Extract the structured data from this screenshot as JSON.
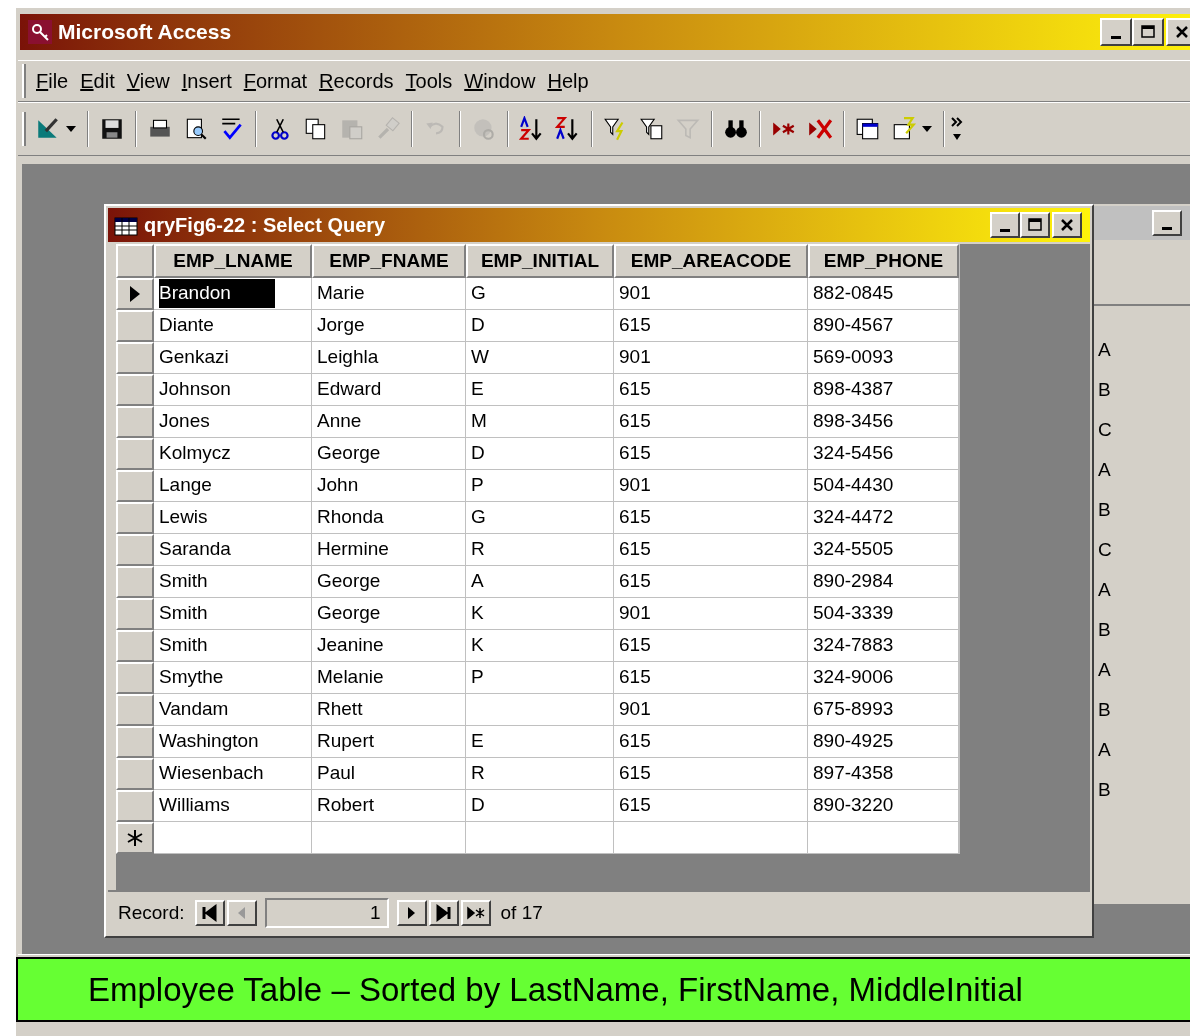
{
  "window": {
    "title": "Microsoft Access"
  },
  "menu": [
    "File",
    "Edit",
    "View",
    "Insert",
    "Format",
    "Records",
    "Tools",
    "Window",
    "Help"
  ],
  "toolbar": [
    [
      {
        "disabled": false
      }
    ],
    [
      {
        "disabled": false
      }
    ],
    [
      {
        "disabled": false
      },
      {
        "disabled": false
      },
      {
        "disabled": false
      }
    ],
    [
      {
        "disabled": false
      },
      {
        "disabled": false
      },
      {
        "disabled": true
      },
      {
        "disabled": true
      }
    ],
    [
      {
        "disabled": true
      }
    ],
    [
      {
        "disabled": true
      }
    ],
    [
      {
        "disabled": false
      },
      {
        "disabled": false
      }
    ],
    [
      {
        "disabled": false
      },
      {
        "disabled": false
      },
      {
        "disabled": true
      }
    ],
    [
      {
        "disabled": false
      }
    ],
    [
      {
        "disabled": false
      },
      {
        "disabled": false
      }
    ],
    [
      {
        "disabled": false
      },
      {
        "disabled": false
      }
    ]
  ],
  "query_window": {
    "title": "qryFig6-22 : Select Query",
    "table": {
      "columns": [
        "EMP_LNAME",
        "EMP_FNAME",
        "EMP_INITIAL",
        "EMP_AREACODE",
        "EMP_PHONE"
      ],
      "rows": [
        {
          "selected": true,
          "cells": [
            "Brandon",
            "Marie",
            "G",
            "901",
            "882-0845"
          ]
        },
        {
          "selected": false,
          "cells": [
            "Diante",
            "Jorge",
            "D",
            "615",
            "890-4567"
          ]
        },
        {
          "selected": false,
          "cells": [
            "Genkazi",
            "Leighla",
            "W",
            "901",
            "569-0093"
          ]
        },
        {
          "selected": false,
          "cells": [
            "Johnson",
            "Edward",
            "E",
            "615",
            "898-4387"
          ]
        },
        {
          "selected": false,
          "cells": [
            "Jones",
            "Anne",
            "M",
            "615",
            "898-3456"
          ]
        },
        {
          "selected": false,
          "cells": [
            "Kolmycz",
            "George",
            "D",
            "615",
            "324-5456"
          ]
        },
        {
          "selected": false,
          "cells": [
            "Lange",
            "John",
            "P",
            "901",
            "504-4430"
          ]
        },
        {
          "selected": false,
          "cells": [
            "Lewis",
            "Rhonda",
            "G",
            "615",
            "324-4472"
          ]
        },
        {
          "selected": false,
          "cells": [
            "Saranda",
            "Hermine",
            "R",
            "615",
            "324-5505"
          ]
        },
        {
          "selected": false,
          "cells": [
            "Smith",
            "George",
            "A",
            "615",
            "890-2984"
          ]
        },
        {
          "selected": false,
          "cells": [
            "Smith",
            "George",
            "K",
            "901",
            "504-3339"
          ]
        },
        {
          "selected": false,
          "cells": [
            "Smith",
            "Jeanine",
            "K",
            "615",
            "324-7883"
          ]
        },
        {
          "selected": false,
          "cells": [
            "Smythe",
            "Melanie",
            "P",
            "615",
            "324-9006"
          ]
        },
        {
          "selected": false,
          "cells": [
            "Vandam",
            "Rhett",
            "",
            "901",
            "675-8993"
          ]
        },
        {
          "selected": false,
          "cells": [
            "Washington",
            "Rupert",
            "E",
            "615",
            "890-4925"
          ]
        },
        {
          "selected": false,
          "cells": [
            "Wiesenbach",
            "Paul",
            "R",
            "615",
            "897-4358"
          ]
        },
        {
          "selected": false,
          "cells": [
            "Williams",
            "Robert",
            "D",
            "615",
            "890-3220"
          ]
        }
      ]
    },
    "navigator": {
      "label": "Record:",
      "current": "1",
      "total": "of 17"
    }
  },
  "background_window": {
    "cells": [
      "A",
      "B",
      "C",
      "A",
      "B",
      "C",
      "A",
      "B",
      "A",
      "B",
      "A",
      "B"
    ]
  },
  "caption": "Employee Table – Sorted by LastName, FirstName, MiddleInitial"
}
